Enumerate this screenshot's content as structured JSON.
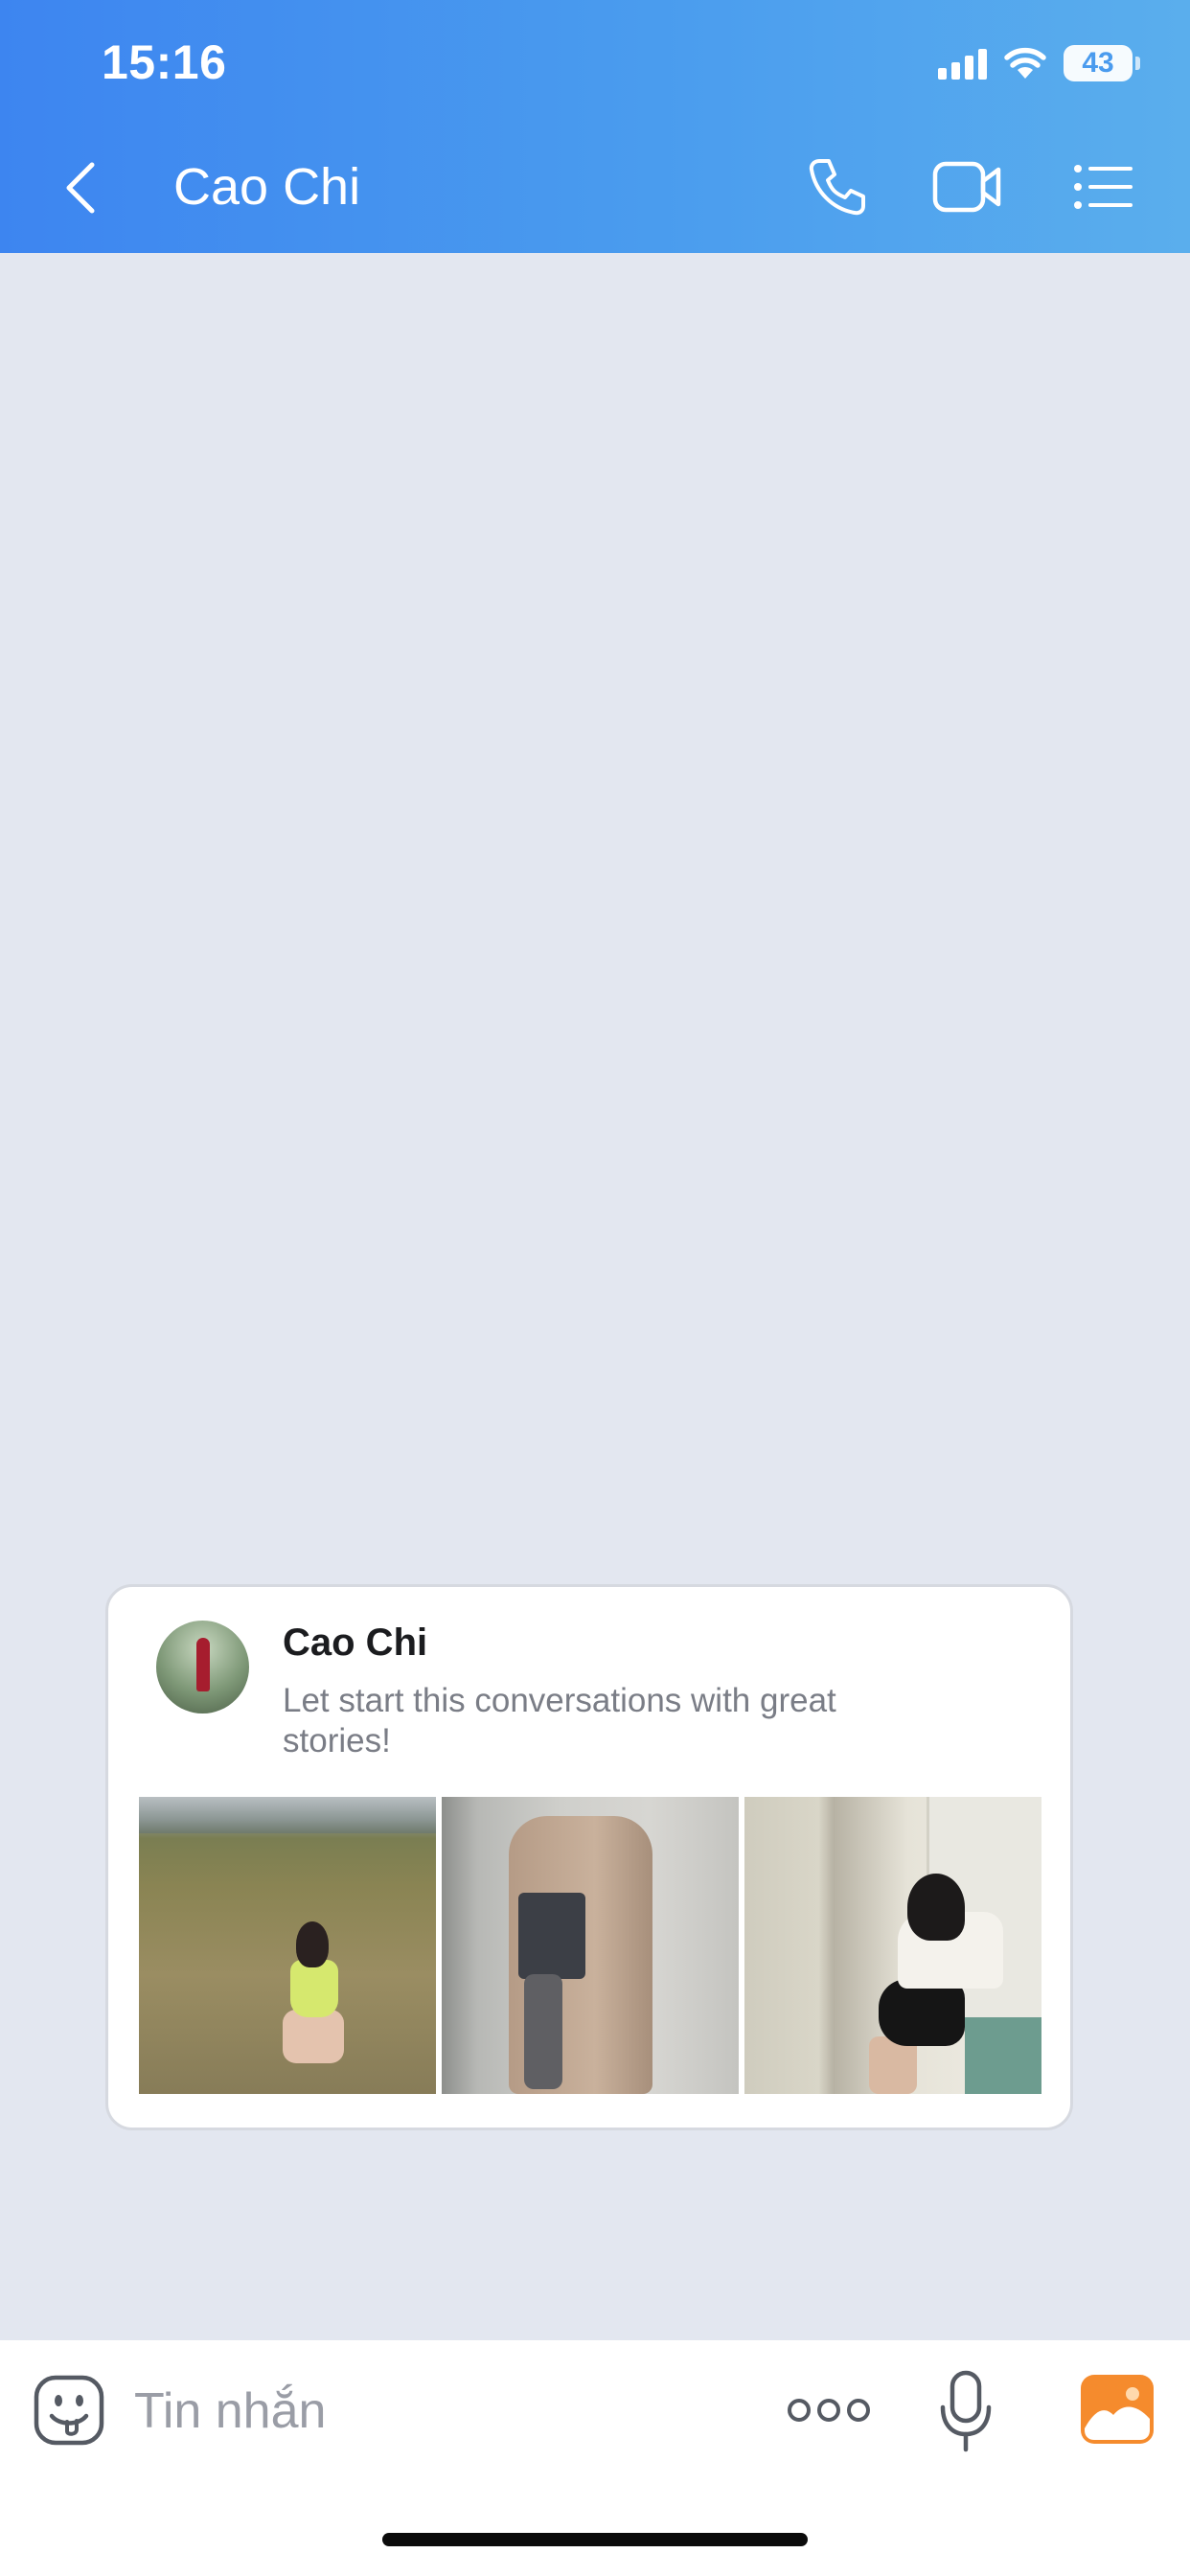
{
  "status_bar": {
    "time": "15:16",
    "battery": "43",
    "icons": [
      "signal-icon",
      "wifi-icon",
      "battery-icon"
    ]
  },
  "header": {
    "title": "Cao Chi",
    "back_icon": "chevron-left-icon",
    "actions": [
      "phone-icon",
      "video-camera-icon",
      "list-menu-icon"
    ]
  },
  "intro_card": {
    "name": "Cao Chi",
    "message": "Let start this conversations with great stories!",
    "photos": [
      "story-photo-1",
      "story-photo-2",
      "story-photo-3"
    ]
  },
  "composer": {
    "placeholder": "Tin nhắn",
    "value": "",
    "icons": [
      "sticker-icon",
      "more-dots-icon",
      "microphone-icon",
      "gallery-icon"
    ]
  },
  "colors": {
    "header_start": "#3d85f0",
    "header_end": "#5aaeed",
    "background": "#e3e7f0",
    "gallery_accent": "#f58b2d"
  }
}
